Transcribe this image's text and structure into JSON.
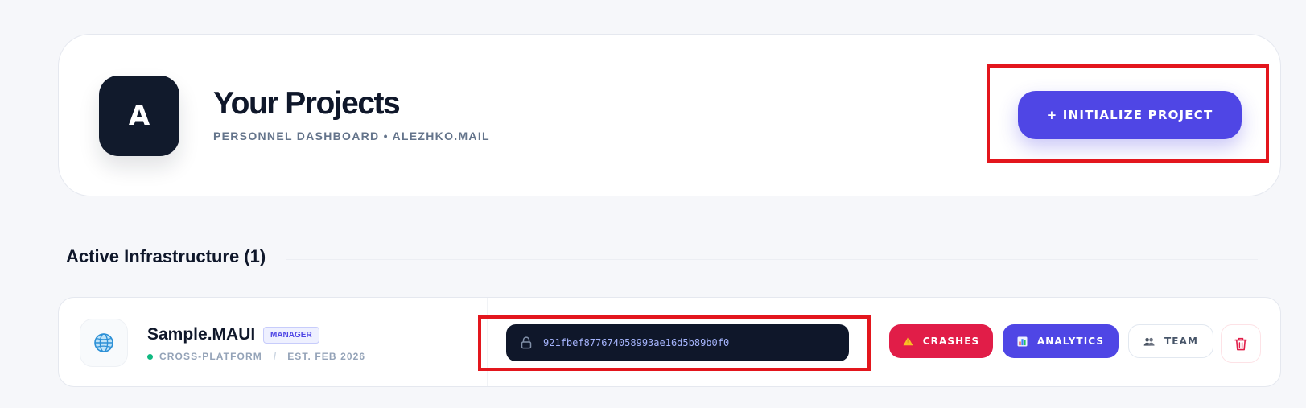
{
  "header": {
    "avatar_initial": "A",
    "title": "Your Projects",
    "subtitle": "PERSONNEL DASHBOARD • ALEZHKO.MAIL",
    "init_button_label": "+ INITIALIZE PROJECT"
  },
  "section": {
    "title": "Active Infrastructure (1)"
  },
  "projects": [
    {
      "icon": "globe-icon",
      "name": "Sample.MAUI",
      "role_badge": "MANAGER",
      "platform": "CROSS-PLATFORM",
      "separator": "/",
      "established": "EST. FEB 2026",
      "api_key": "921fbef877674058993ae16d5b89b0f0",
      "actions": {
        "crashes_label": "CRASHES",
        "analytics_label": "ANALYTICS",
        "team_label": "TEAM"
      }
    }
  ],
  "colors": {
    "accent": "#4f46e5",
    "danger": "#e11d48",
    "dark": "#0f172a",
    "status_ok": "#10b981",
    "highlight": "#e3161d"
  }
}
